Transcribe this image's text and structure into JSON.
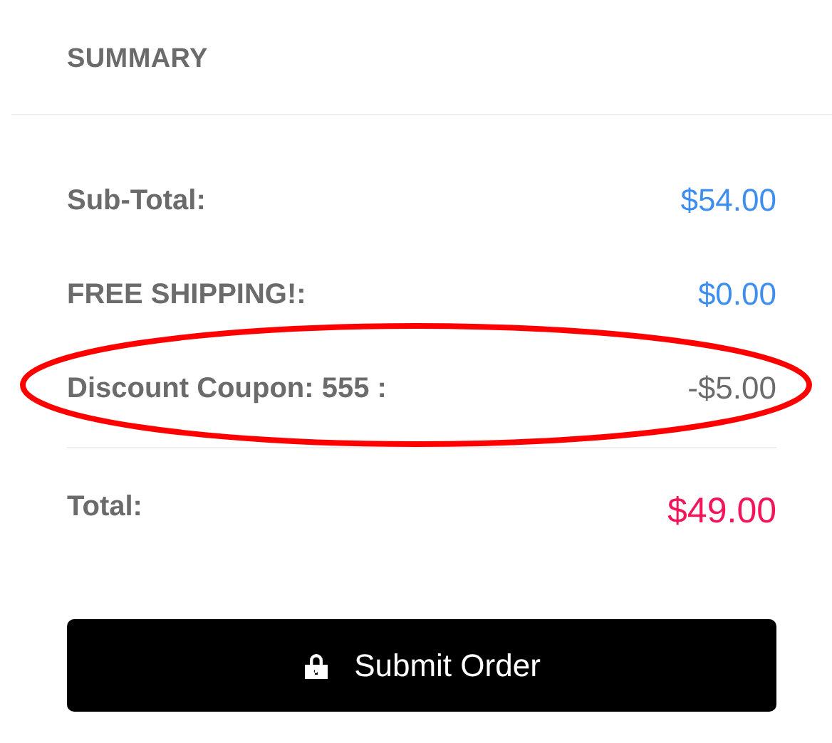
{
  "header": {
    "title": "SUMMARY"
  },
  "lines": [
    {
      "label": "Sub-Total:",
      "value": "$54.00",
      "color": "#3d8ef0",
      "highlighted": false
    },
    {
      "label": "FREE SHIPPING!:",
      "value": "$0.00",
      "color": "#3d8ef0",
      "highlighted": false
    },
    {
      "label": "Discount Coupon: 555 :",
      "value": "-$5.00",
      "color": "#6b6b6b",
      "highlighted": true
    }
  ],
  "total": {
    "label": "Total:",
    "value": "$49.00",
    "color": "#f3155a"
  },
  "submit_button": {
    "label": "Submit Order"
  }
}
